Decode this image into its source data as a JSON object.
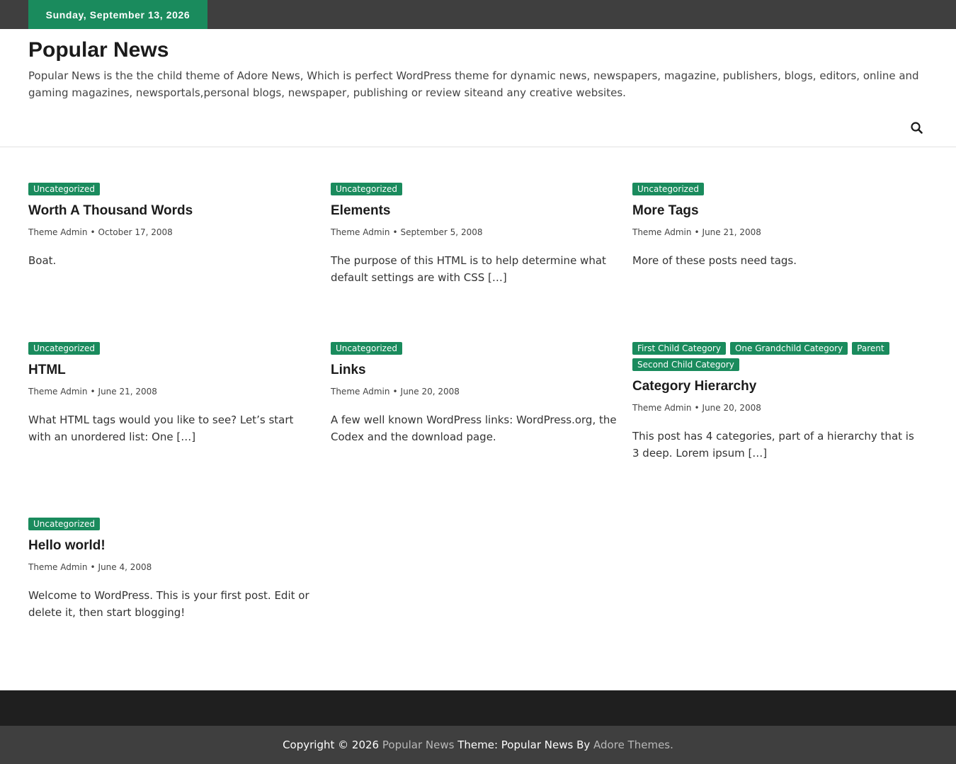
{
  "topbar": {
    "date": "Sunday, September 13, 2026"
  },
  "header": {
    "title": "Popular News",
    "description": "Popular News is the the child theme of Adore News, Which is perfect WordPress theme for dynamic news, newspapers, magazine, publishers, blogs, editors, online and gaming magazines, newsportals,personal blogs, newspaper, publishing or review siteand any creative websites."
  },
  "search": {
    "icon": "search-icon"
  },
  "posts": [
    {
      "categories": [
        "Uncategorized"
      ],
      "title": "Worth A Thousand Words",
      "author": "Theme Admin",
      "date": "October 17, 2008",
      "excerpt": "Boat."
    },
    {
      "categories": [
        "Uncategorized"
      ],
      "title": "Elements",
      "author": "Theme Admin",
      "date": "September 5, 2008",
      "excerpt": "The purpose of this HTML is to help determine what default settings are with CSS […]"
    },
    {
      "categories": [
        "Uncategorized"
      ],
      "title": "More Tags",
      "author": "Theme Admin",
      "date": "June 21, 2008",
      "excerpt": "More of these posts need tags."
    },
    {
      "categories": [
        "Uncategorized"
      ],
      "title": "HTML",
      "author": "Theme Admin",
      "date": "June 21, 2008",
      "excerpt": "What HTML tags would you like to see? Let’s start with an unordered list: One […]"
    },
    {
      "categories": [
        "Uncategorized"
      ],
      "title": "Links",
      "author": "Theme Admin",
      "date": "June 20, 2008",
      "excerpt": "A few well known WordPress links: WordPress.org, the Codex and the download page."
    },
    {
      "categories": [
        "First Child Category",
        "One Grandchild Category",
        "Parent",
        "Second Child Category"
      ],
      "title": "Category Hierarchy",
      "author": "Theme Admin",
      "date": "June 20, 2008",
      "excerpt": "This post has 4 categories, part of a hierarchy that is 3 deep. Lorem ipsum […]"
    },
    {
      "categories": [
        "Uncategorized"
      ],
      "title": "Hello world!",
      "author": "Theme Admin",
      "date": "June 4, 2008",
      "excerpt": "Welcome to WordPress. This is your first post. Edit or delete it, then start blogging!"
    }
  ],
  "footer": {
    "copyright": "Copyright © 2026",
    "site_link": "Popular News",
    "theme_text": "Theme: Popular News By",
    "author_link": "Adore Themes",
    "period": "."
  },
  "colors": {
    "accent": "#1a8b5d",
    "topbar": "#3f3f3f",
    "footer_dark": "#1f1f1f"
  }
}
